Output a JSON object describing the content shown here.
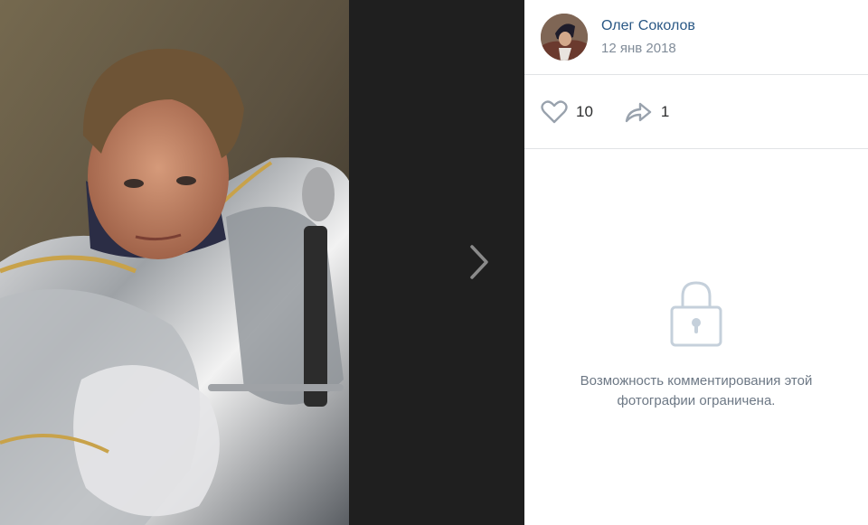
{
  "photo": {
    "alt": "Портрет мужчины в рыцарских доспехах"
  },
  "navigation": {
    "next_icon": "chevron-right-icon"
  },
  "post": {
    "author_name": "Олег Соколов",
    "date": "12 янв 2018",
    "avatar_icon": "avatar"
  },
  "actions": {
    "likes": {
      "icon": "heart-icon",
      "count": "10"
    },
    "shares": {
      "icon": "share-arrow-icon",
      "count": "1"
    }
  },
  "comments": {
    "icon": "lock-icon",
    "message_line1": "Возможность комментирования этой",
    "message_line2": "фотографии ограничена."
  },
  "colors": {
    "link": "#2a5885",
    "muted": "#818c99",
    "icon": "#99a2ad",
    "divider": "#e1e3e6",
    "background_dark": "#1f1f1f"
  }
}
